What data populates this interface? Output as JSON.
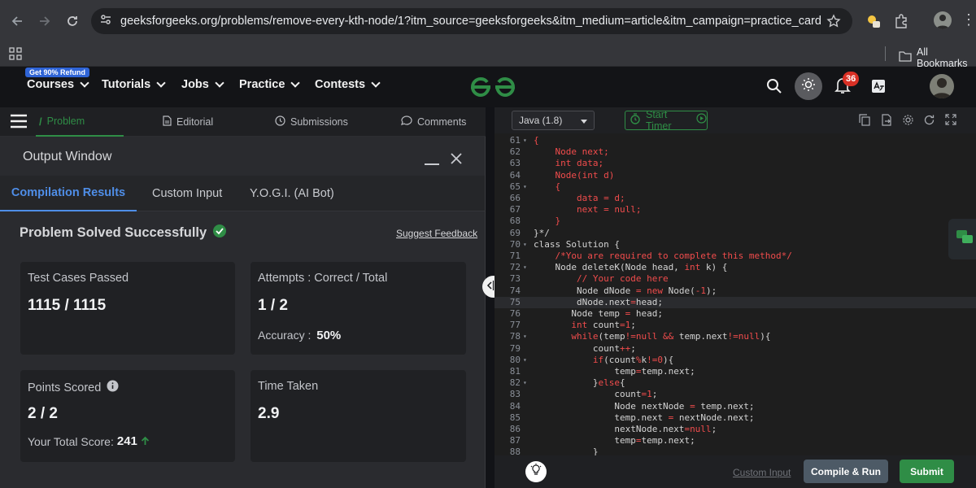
{
  "browser": {
    "url": "geeksforgeeks.org/problems/remove-every-kth-node/1?itm_source=geeksforgeeks&itm_medium=article&itm_campaign=practice_card",
    "bookmarks_label": "All Bookmarks"
  },
  "header": {
    "badge": "Get 90% Refund",
    "menu": [
      "Courses",
      "Tutorials",
      "Jobs",
      "Practice",
      "Contests"
    ],
    "notification_count": "36"
  },
  "problem_tabs": [
    "Problem",
    "Editorial",
    "Submissions",
    "Comments"
  ],
  "output_window": {
    "title": "Output Window",
    "tabs": [
      "Compilation Results",
      "Custom Input",
      "Y.O.G.I. (AI Bot)"
    ],
    "status": "Problem Solved Successfully",
    "suggest_feedback": "Suggest Feedback",
    "cards": {
      "test_cases_label": "Test Cases Passed",
      "test_cases_value": "1115 / 1115",
      "attempts_label": "Attempts : Correct / Total",
      "attempts_value": "1 / 2",
      "accuracy_label": "Accuracy :",
      "accuracy_value": "50%",
      "points_label": "Points Scored",
      "points_value": "2 / 2",
      "total_score_label": "Your Total Score:",
      "total_score_value": "241",
      "time_label": "Time Taken",
      "time_value": "2.9"
    }
  },
  "editor": {
    "language": "Java (1.8)",
    "timer_label": "Start Timer",
    "lines": [
      {
        "n": "61",
        "fold": true,
        "text": "{"
      },
      {
        "n": "62",
        "fold": false,
        "text": "    Node next;"
      },
      {
        "n": "63",
        "fold": false,
        "text": "    int data;"
      },
      {
        "n": "64",
        "fold": false,
        "text": "    Node(int d)"
      },
      {
        "n": "65",
        "fold": true,
        "text": "    {"
      },
      {
        "n": "66",
        "fold": false,
        "text": "        data = d;"
      },
      {
        "n": "67",
        "fold": false,
        "text": "        next = null;"
      },
      {
        "n": "68",
        "fold": false,
        "text": "    }"
      },
      {
        "n": "69",
        "fold": false,
        "text": "}*/"
      },
      {
        "n": "70",
        "fold": true,
        "text": "class Solution {"
      },
      {
        "n": "71",
        "fold": false,
        "text": "    /*You are required to complete this method*/"
      },
      {
        "n": "72",
        "fold": true,
        "text": "    Node deleteK(Node head, int k) {"
      },
      {
        "n": "73",
        "fold": false,
        "text": "        // Your code here"
      },
      {
        "n": "74",
        "fold": false,
        "text": "        Node dNode = new Node(-1);"
      },
      {
        "n": "75",
        "fold": false,
        "text": "        dNode.next=head;"
      },
      {
        "n": "76",
        "fold": false,
        "text": "       Node temp = head;"
      },
      {
        "n": "77",
        "fold": false,
        "text": "       int count=1;"
      },
      {
        "n": "78",
        "fold": true,
        "text": "       while(temp!=null && temp.next!=null){"
      },
      {
        "n": "79",
        "fold": false,
        "text": "           count++;"
      },
      {
        "n": "80",
        "fold": true,
        "text": "           if(count%k!=0){"
      },
      {
        "n": "81",
        "fold": false,
        "text": "               temp=temp.next;"
      },
      {
        "n": "82",
        "fold": true,
        "text": "           }else{"
      },
      {
        "n": "83",
        "fold": false,
        "text": "               count=1;"
      },
      {
        "n": "84",
        "fold": false,
        "text": "               Node nextNode = temp.next;"
      },
      {
        "n": "85",
        "fold": false,
        "text": "               temp.next = nextNode.next;"
      },
      {
        "n": "86",
        "fold": false,
        "text": "               nextNode.next=null;"
      },
      {
        "n": "87",
        "fold": false,
        "text": "               temp=temp.next;"
      },
      {
        "n": "88",
        "fold": false,
        "text": "           }"
      }
    ],
    "active_line": "75",
    "custom_input_label": "Custom Input",
    "compile_label": "Compile & Run",
    "submit_label": "Submit"
  },
  "colors": {
    "accent_green": "#2f8d46",
    "keyword": "#f14c4c",
    "comment": "#e05252",
    "link_blue": "#4f8ee8"
  }
}
